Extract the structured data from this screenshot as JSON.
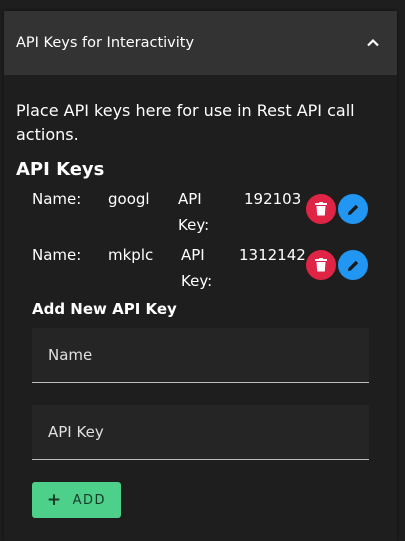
{
  "header": {
    "title": "API Keys for Interactivity"
  },
  "intro": "Place API keys here for use in Rest API call actions.",
  "section_title": "API Keys",
  "keys": [
    {
      "name_label": "Name:",
      "name": "googl",
      "key_label_1": "API",
      "key_label_2": "Key:",
      "key": "192103"
    },
    {
      "name_label": "Name:",
      "name": "mkplc",
      "key_label_1": "API",
      "key_label_2": "Key:",
      "key": "1312142"
    }
  ],
  "add_section": {
    "title": "Add New API Key",
    "name_placeholder": "Name",
    "key_placeholder": "API Key",
    "add_label": "ADD",
    "add_icon": "+"
  },
  "colors": {
    "delete": "#e02445",
    "edit": "#2196f3",
    "add": "#4cd08a",
    "header_bg": "#333333",
    "panel_bg": "#1e1e1e"
  },
  "icons": {
    "collapse": "chevron-up-icon",
    "delete": "trash-icon",
    "edit": "pencil-icon",
    "add": "plus-icon"
  }
}
